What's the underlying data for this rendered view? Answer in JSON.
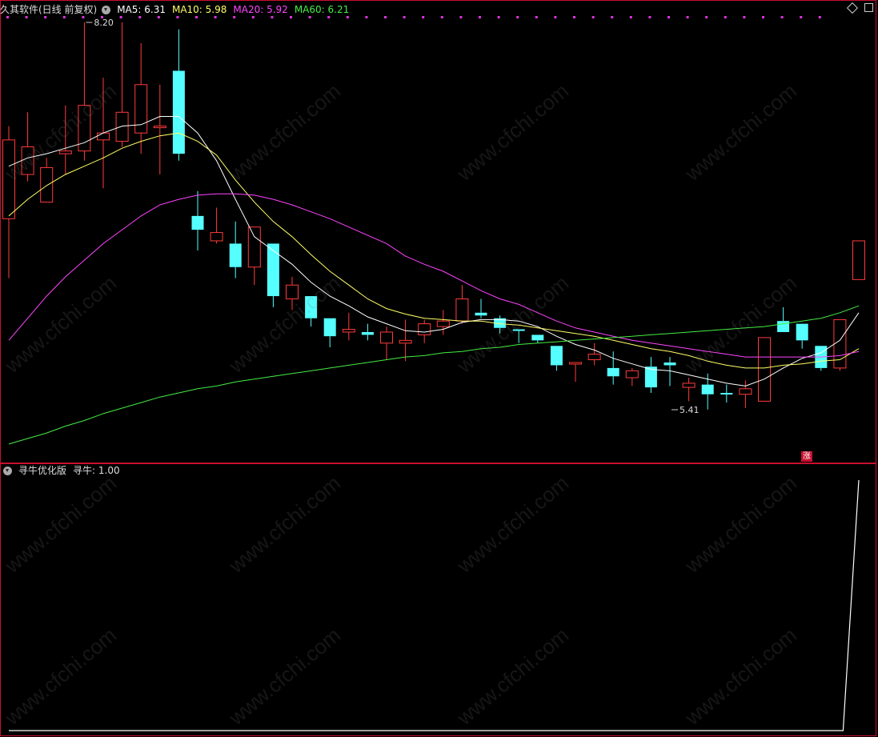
{
  "header": {
    "title": "久其软件(日线 前复权)",
    "ma5": "MA5: 6.31",
    "ma10": "MA10: 5.98",
    "ma20": "MA20: 5.92",
    "ma60": "MA60: 6.21",
    "colors": {
      "ma5": "#ffffff",
      "ma10": "#ffff66",
      "ma20": "#ff44ff",
      "ma60": "#44ee44"
    }
  },
  "subpanel": {
    "title": "寻牛优化版",
    "value_label": "寻牛: 1.00"
  },
  "badge": "涨",
  "watermark": "www.cfchi.com",
  "chart_data": [
    {
      "type": "candlestick",
      "annotations": [
        {
          "text": "8.20",
          "index": 4,
          "value": 8.2
        },
        {
          "text": "5.41",
          "index": 35,
          "value": 5.41
        }
      ],
      "colors": {
        "up": "#ff3b3b",
        "down": "#55ffff"
      },
      "candles": [
        {
          "o": 6.78,
          "h": 7.45,
          "l": 6.35,
          "c": 7.35
        },
        {
          "o": 7.1,
          "h": 7.55,
          "l": 7.05,
          "c": 7.3
        },
        {
          "o": 6.9,
          "h": 7.22,
          "l": 6.9,
          "c": 7.15
        },
        {
          "o": 7.25,
          "h": 7.6,
          "l": 7.1,
          "c": 7.27
        },
        {
          "o": 7.27,
          "h": 8.2,
          "l": 7.2,
          "c": 7.6
        },
        {
          "o": 7.35,
          "h": 7.8,
          "l": 7.0,
          "c": 7.4
        },
        {
          "o": 7.34,
          "h": 8.2,
          "l": 7.3,
          "c": 7.55
        },
        {
          "o": 7.4,
          "h": 8.05,
          "l": 7.25,
          "c": 7.75
        },
        {
          "o": 7.45,
          "h": 7.75,
          "l": 7.1,
          "c": 7.45
        },
        {
          "o": 7.85,
          "h": 8.15,
          "l": 7.2,
          "c": 7.25
        },
        {
          "o": 6.8,
          "h": 6.98,
          "l": 6.55,
          "c": 6.7
        },
        {
          "o": 6.62,
          "h": 6.86,
          "l": 6.6,
          "c": 6.68
        },
        {
          "o": 6.6,
          "h": 6.76,
          "l": 6.35,
          "c": 6.43
        },
        {
          "o": 6.43,
          "h": 6.72,
          "l": 6.3,
          "c": 6.72
        },
        {
          "o": 6.6,
          "h": 6.6,
          "l": 6.14,
          "c": 6.22
        },
        {
          "o": 6.2,
          "h": 6.36,
          "l": 6.12,
          "c": 6.3
        },
        {
          "o": 6.22,
          "h": 6.22,
          "l": 6.0,
          "c": 6.06
        },
        {
          "o": 6.06,
          "h": 6.06,
          "l": 5.85,
          "c": 5.93
        },
        {
          "o": 5.96,
          "h": 6.1,
          "l": 5.9,
          "c": 5.98
        },
        {
          "o": 5.96,
          "h": 6.02,
          "l": 5.9,
          "c": 5.94
        },
        {
          "o": 5.88,
          "h": 6.0,
          "l": 5.76,
          "c": 5.96
        },
        {
          "o": 5.88,
          "h": 6.05,
          "l": 5.75,
          "c": 5.9
        },
        {
          "o": 5.94,
          "h": 6.05,
          "l": 5.88,
          "c": 6.02
        },
        {
          "o": 6.0,
          "h": 6.12,
          "l": 5.94,
          "c": 6.04
        },
        {
          "o": 6.04,
          "h": 6.3,
          "l": 6.02,
          "c": 6.2
        },
        {
          "o": 6.1,
          "h": 6.2,
          "l": 6.06,
          "c": 6.08
        },
        {
          "o": 6.06,
          "h": 6.08,
          "l": 5.95,
          "c": 5.99
        },
        {
          "o": 5.98,
          "h": 5.98,
          "l": 5.88,
          "c": 5.97
        },
        {
          "o": 5.94,
          "h": 5.94,
          "l": 5.88,
          "c": 5.9
        },
        {
          "o": 5.86,
          "h": 5.86,
          "l": 5.68,
          "c": 5.72
        },
        {
          "o": 5.74,
          "h": 5.74,
          "l": 5.6,
          "c": 5.74
        },
        {
          "o": 5.76,
          "h": 5.88,
          "l": 5.72,
          "c": 5.8
        },
        {
          "o": 5.7,
          "h": 5.82,
          "l": 5.58,
          "c": 5.64
        },
        {
          "o": 5.63,
          "h": 5.7,
          "l": 5.57,
          "c": 5.68
        },
        {
          "o": 5.71,
          "h": 5.78,
          "l": 5.52,
          "c": 5.56
        },
        {
          "o": 5.74,
          "h": 5.78,
          "l": 5.57,
          "c": 5.72
        },
        {
          "o": 5.56,
          "h": 5.63,
          "l": 5.46,
          "c": 5.59
        },
        {
          "o": 5.58,
          "h": 5.66,
          "l": 5.4,
          "c": 5.51
        },
        {
          "o": 5.52,
          "h": 5.58,
          "l": 5.45,
          "c": 5.51
        },
        {
          "o": 5.51,
          "h": 5.61,
          "l": 5.41,
          "c": 5.55
        },
        {
          "o": 5.46,
          "h": 5.92,
          "l": 5.46,
          "c": 5.92
        },
        {
          "o": 6.04,
          "h": 6.14,
          "l": 5.96,
          "c": 5.96
        },
        {
          "o": 6.02,
          "h": 6.02,
          "l": 5.84,
          "c": 5.9
        },
        {
          "o": 5.86,
          "h": 5.86,
          "l": 5.68,
          "c": 5.7
        },
        {
          "o": 5.7,
          "h": 6.05,
          "l": 5.68,
          "c": 6.05
        },
        {
          "o": 6.34,
          "h": 6.62,
          "l": 6.34,
          "c": 6.62
        }
      ],
      "ma": {
        "MA5": [
          7.16,
          7.22,
          7.25,
          7.29,
          7.33,
          7.4,
          7.45,
          7.46,
          7.52,
          7.52,
          7.4,
          7.2,
          6.92,
          6.65,
          6.55,
          6.45,
          6.32,
          6.22,
          6.15,
          6.07,
          6.02,
          5.97,
          5.96,
          5.98,
          6.03,
          6.05,
          6.05,
          6.04,
          6.0,
          5.93,
          5.87,
          5.83,
          5.77,
          5.73,
          5.69,
          5.68,
          5.65,
          5.62,
          5.59,
          5.57,
          5.62,
          5.7,
          5.77,
          5.81,
          5.9,
          6.1
        ],
        "MA10": [
          6.8,
          6.92,
          7.02,
          7.1,
          7.16,
          7.22,
          7.29,
          7.34,
          7.38,
          7.4,
          7.34,
          7.24,
          7.06,
          6.9,
          6.76,
          6.65,
          6.52,
          6.4,
          6.3,
          6.2,
          6.13,
          6.09,
          6.06,
          6.05,
          6.04,
          6.04,
          6.02,
          6.01,
          5.99,
          5.97,
          5.95,
          5.93,
          5.9,
          5.87,
          5.84,
          5.82,
          5.79,
          5.75,
          5.72,
          5.7,
          5.7,
          5.72,
          5.73,
          5.75,
          5.76,
          5.84
        ],
        "MA20": [
          5.9,
          6.06,
          6.22,
          6.36,
          6.48,
          6.6,
          6.7,
          6.8,
          6.88,
          6.92,
          6.95,
          6.96,
          6.96,
          6.95,
          6.92,
          6.88,
          6.83,
          6.78,
          6.72,
          6.66,
          6.6,
          6.51,
          6.45,
          6.4,
          6.33,
          6.26,
          6.2,
          6.16,
          6.1,
          6.04,
          5.99,
          5.96,
          5.93,
          5.9,
          5.88,
          5.86,
          5.84,
          5.82,
          5.8,
          5.78,
          5.78,
          5.78,
          5.78,
          5.78,
          5.79,
          5.82
        ],
        "MA60": [
          5.15,
          5.19,
          5.23,
          5.28,
          5.32,
          5.37,
          5.41,
          5.45,
          5.49,
          5.52,
          5.55,
          5.57,
          5.6,
          5.62,
          5.64,
          5.66,
          5.68,
          5.7,
          5.72,
          5.74,
          5.76,
          5.78,
          5.79,
          5.81,
          5.82,
          5.84,
          5.85,
          5.87,
          5.88,
          5.89,
          5.9,
          5.91,
          5.92,
          5.93,
          5.94,
          5.95,
          5.96,
          5.97,
          5.98,
          5.99,
          6.0,
          6.02,
          6.04,
          6.06,
          6.1,
          6.15
        ]
      }
    },
    {
      "type": "line",
      "series": [
        {
          "name": "寻牛",
          "values": [
            0,
            0,
            0,
            0,
            0,
            0,
            0,
            0,
            0,
            0,
            0,
            0,
            0,
            0,
            0,
            0,
            0,
            0,
            0,
            0,
            0,
            0,
            0,
            0,
            0,
            0,
            0,
            0,
            0,
            0,
            0,
            0,
            0,
            0,
            0,
            0,
            0,
            0,
            0,
            0,
            0,
            0,
            0,
            0,
            0,
            1.0
          ]
        }
      ],
      "ylim": [
        0,
        1
      ],
      "colors": {
        "line": "#ffffff"
      }
    }
  ]
}
